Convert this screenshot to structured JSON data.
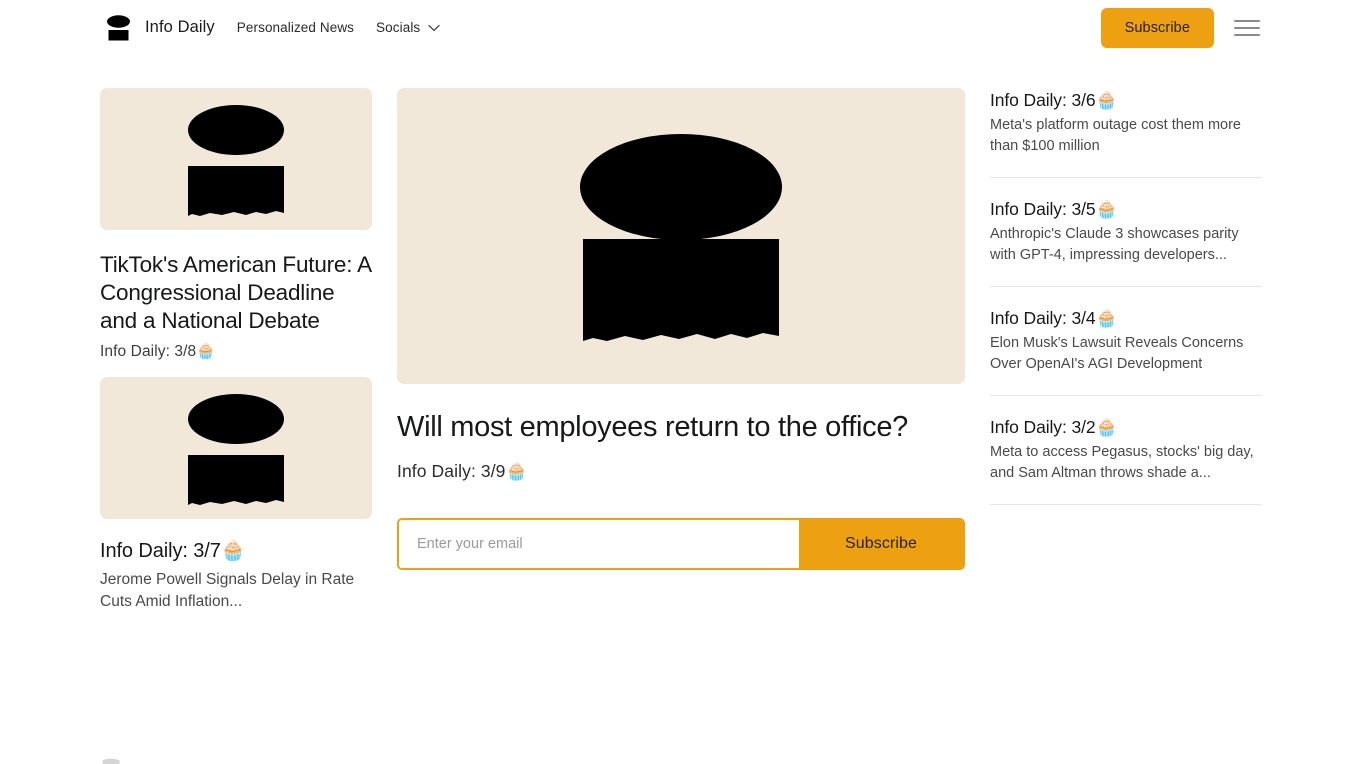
{
  "header": {
    "logo_icon": "info-daily-logo-icon",
    "brand_name": "Info Daily",
    "nav": [
      {
        "label": "Personalized News",
        "has_dropdown": false
      },
      {
        "label": "Socials",
        "has_dropdown": true,
        "icon": "chevron-down-icon"
      }
    ],
    "subscribe_label": "Subscribe",
    "menu_icon": "hamburger-menu-icon"
  },
  "colors": {
    "accent_orange": "#EDA012",
    "placeholder_beige": "#F2E8DA",
    "divider_gray": "#e6e6e6",
    "text_primary": "#16181a",
    "text_secondary": "#4a4a4a"
  },
  "left_column": {
    "featured": {
      "image_alt": "broken-image-placeholder",
      "title": "TikTok's American Future: A Congressional Deadline and a National Debate",
      "meta": "Info Daily: 3/8🧁"
    },
    "second": {
      "image_alt": "broken-image-placeholder",
      "title": "Info Daily: 3/7🧁",
      "summary": "Jerome Powell Signals Delay in Rate Cuts Amid Inflation..."
    }
  },
  "main": {
    "hero": {
      "image_alt": "broken-image-placeholder",
      "title": "Will most employees return to the office?",
      "meta": "Info Daily: 3/9🧁"
    },
    "subscribe": {
      "placeholder": "Enter your email",
      "value": "",
      "button_label": "Subscribe"
    }
  },
  "right_column": {
    "items": [
      {
        "title": "Info Daily: 3/6🧁",
        "summary": "Meta's platform outage cost them more than $100 million"
      },
      {
        "title": "Info Daily: 3/5🧁",
        "summary": "Anthropic's Claude 3 showcases parity with GPT-4, impressing developers..."
      },
      {
        "title": "Info Daily: 3/4🧁",
        "summary": "Elon Musk's Lawsuit Reveals Concerns Over OpenAI's AGI Development"
      },
      {
        "title": "Info Daily: 3/2🧁",
        "summary": "Meta to access Pegasus, stocks' big day, and Sam Altman throws shade a..."
      }
    ]
  }
}
